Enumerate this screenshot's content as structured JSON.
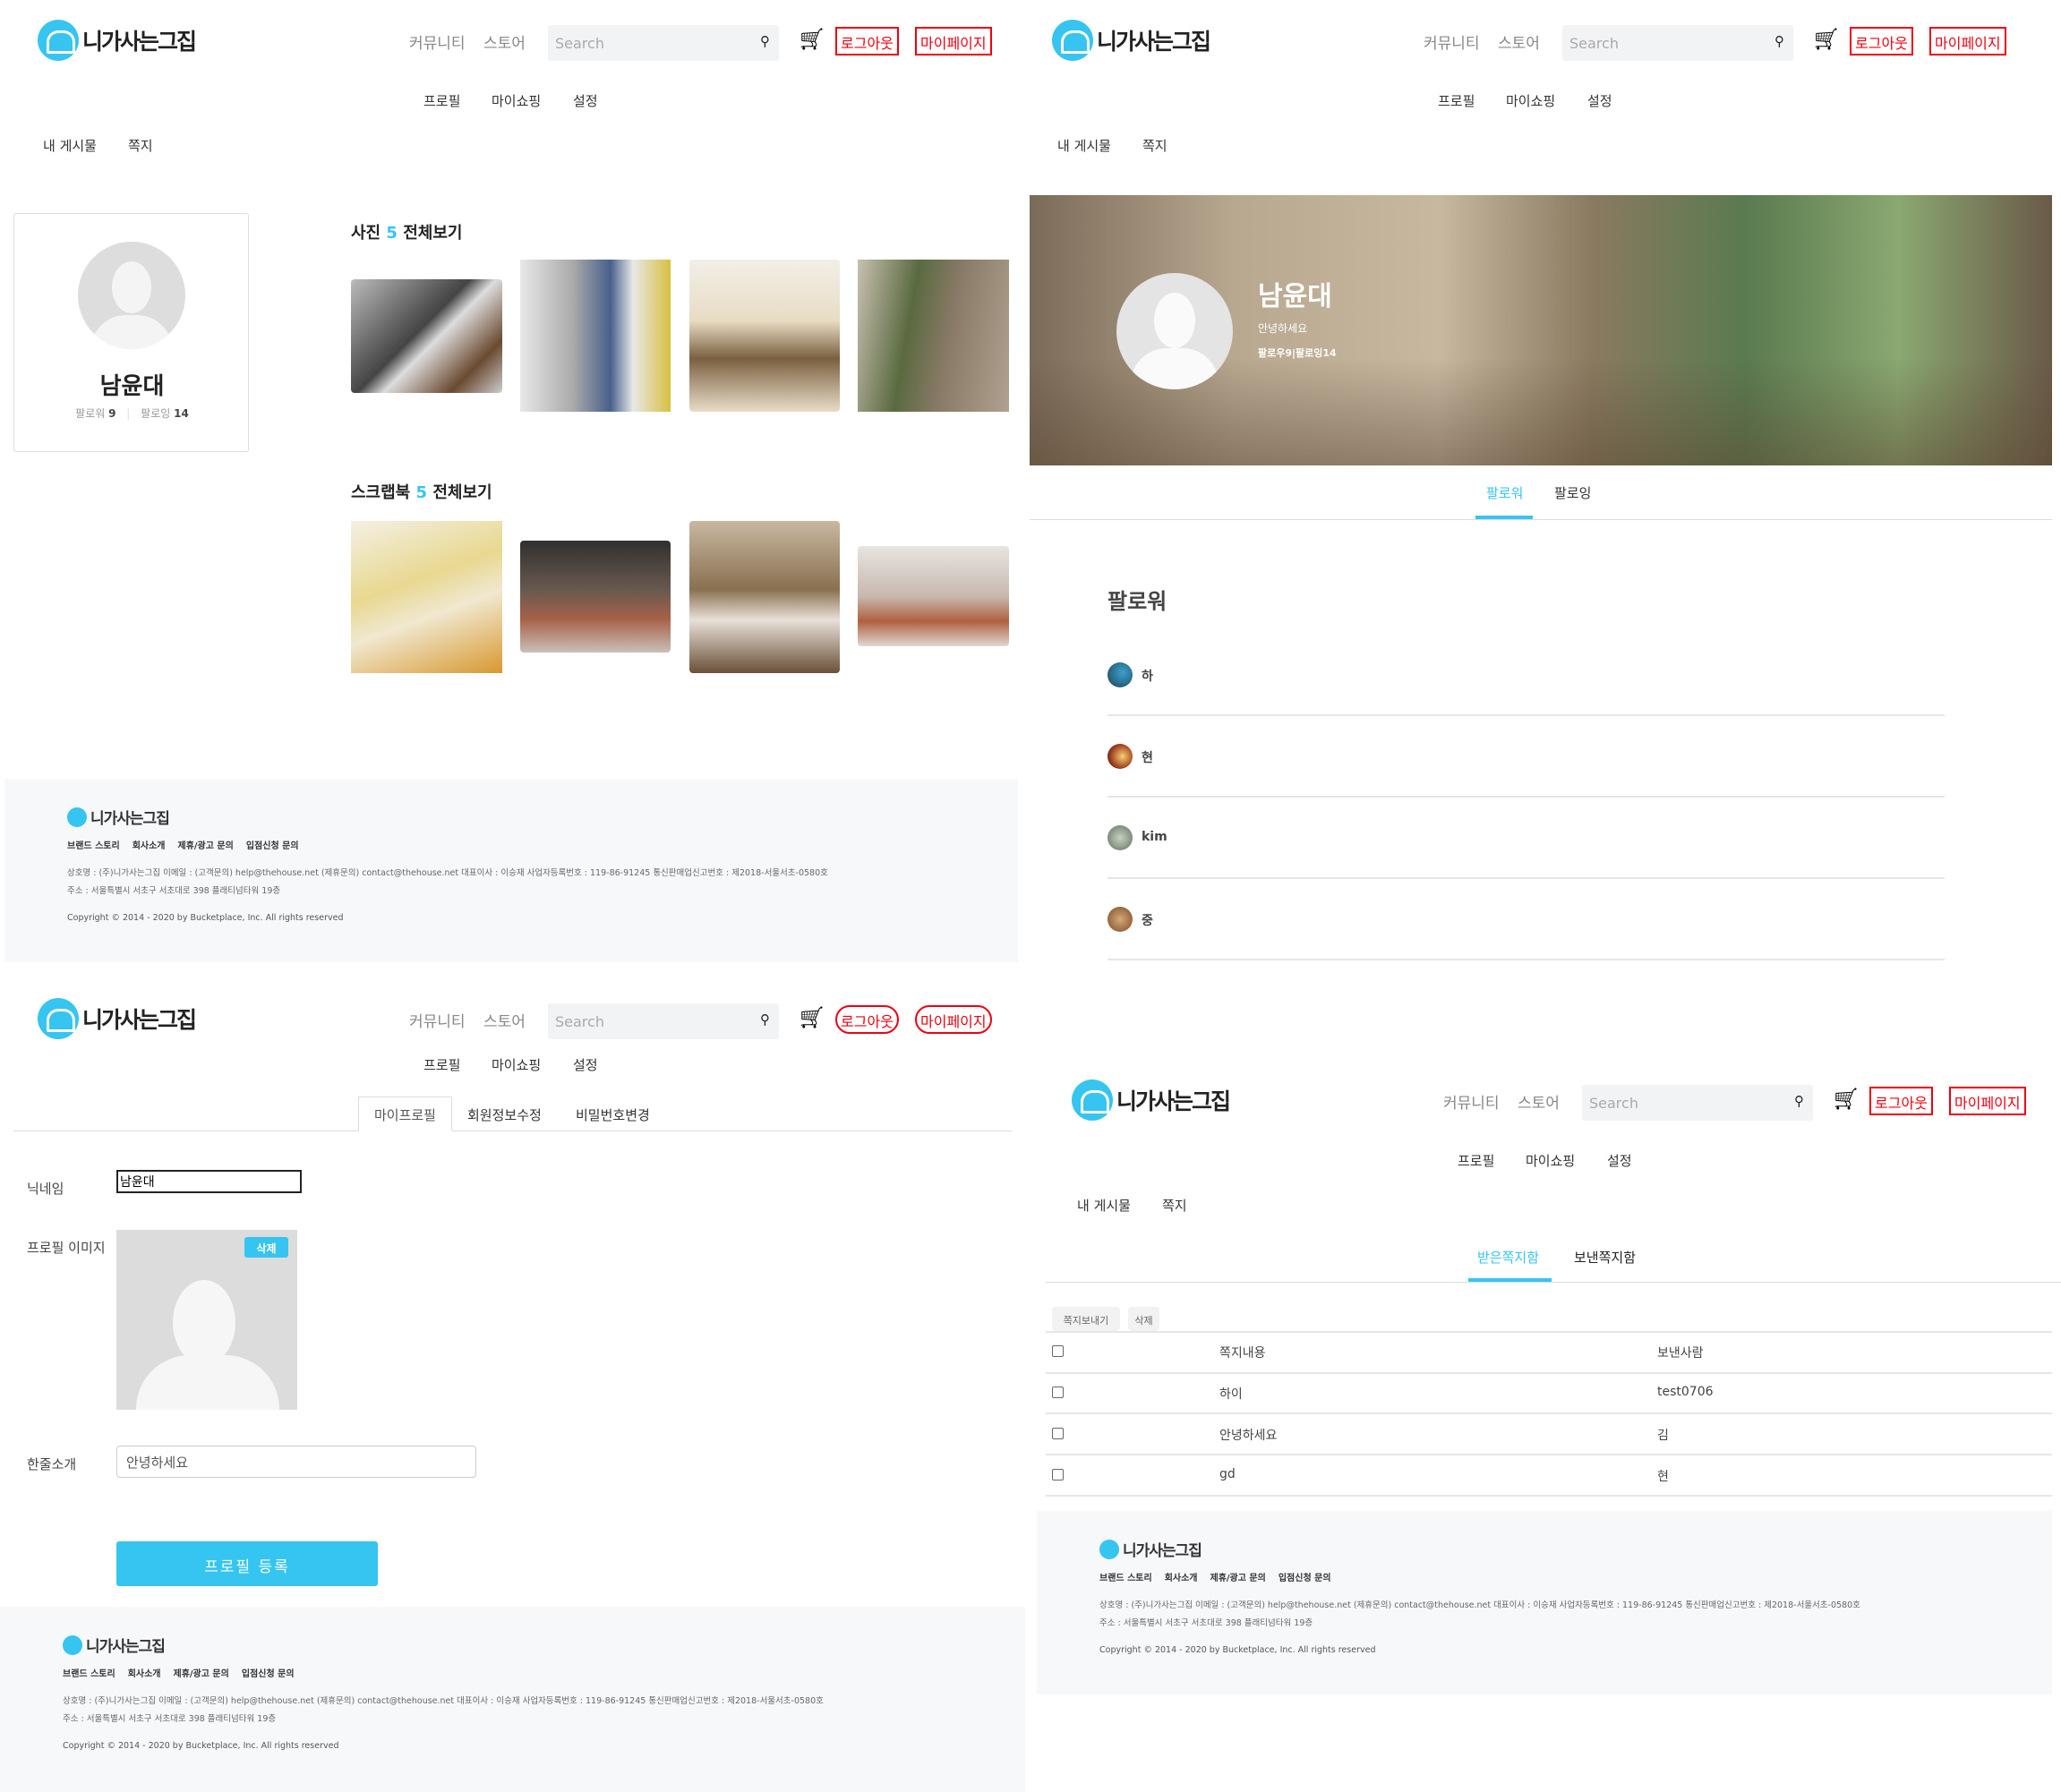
{
  "header": {
    "logo": "니가사는그집",
    "nav": [
      "커뮤니티",
      "스토어"
    ],
    "search_placeholder": "Search",
    "logout": "로그아웃",
    "mypage": "마이페이지",
    "subnav": [
      "프로필",
      "마이쇼핑",
      "설정"
    ],
    "tabs": [
      "내 게시물",
      "쪽지"
    ]
  },
  "footer": {
    "logo": "니가사는그집",
    "links": [
      "브랜드 스토리",
      "회사소개",
      "제휴/광고 문의",
      "입점신청 문의"
    ],
    "info_line1": "상호명 : (주)니가사는그집   이메일 : (고객문의) help@thehouse.net (제휴문의) contact@thehouse.net   대표이사 : 이승재   사업자등록번호 : 119-86-91245   통신판매업신고번호 : 제2018-서울서초-0580호",
    "info_line2": "주소 : 서울특별시 서초구 서초대로 398 플래티넘타워 19층",
    "copyright": "Copyright © 2014 - 2020 by Bucketplace, Inc. All rights reserved"
  },
  "profile_page": {
    "name": "남윤대",
    "follower_label": "팔로워",
    "follower_count": "9",
    "following_label": "팔로잉",
    "following_count": "14",
    "photos": {
      "label": "사진",
      "count": "5",
      "view_all": "전체보기"
    },
    "scrapbook": {
      "label": "스크랩북",
      "count": "5",
      "view_all": "전체보기"
    }
  },
  "follow_page": {
    "name": "남윤대",
    "intro": "안녕하세요",
    "stats": "팔로우9|팔로잉14",
    "tabs": [
      "팔로워",
      "팔로잉"
    ],
    "heading": "팔로워",
    "followers": [
      "하",
      "현",
      "kim",
      "중"
    ]
  },
  "edit_page": {
    "tabs": [
      "마이프로필",
      "회원정보수정",
      "비밀번호변경"
    ],
    "nickname_label": "닉네임",
    "nickname_value": "남윤대",
    "image_label": "프로필 이미지",
    "delete": "삭제",
    "intro_label": "한줄소개",
    "intro_value": "안녕하세요",
    "submit": "프로필 등록"
  },
  "message_page": {
    "tabs": [
      "받은쪽지함",
      "보낸쪽지함"
    ],
    "send_button": "쪽지보내기",
    "delete_button": "삭제",
    "columns": [
      "쪽지내용",
      "보낸사람"
    ],
    "rows": [
      {
        "content": "하이",
        "sender": "test0706"
      },
      {
        "content": "안녕하세요",
        "sender": "김"
      },
      {
        "content": "gd",
        "sender": "현"
      }
    ]
  },
  "colors": {
    "accent": "#35c5f0",
    "red": "#ee1111"
  }
}
